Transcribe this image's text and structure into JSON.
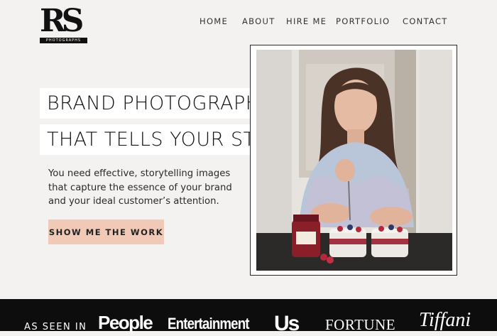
{
  "logo": {
    "mark": "RS",
    "sub": "PHOTOGRAPHS"
  },
  "nav": [
    {
      "label": "HOME"
    },
    {
      "label": "ABOUT"
    },
    {
      "label": "HIRE ME"
    },
    {
      "label": "PORTFOLIO"
    },
    {
      "label": "CONTACT"
    }
  ],
  "hero": {
    "headline_line1": "BRAND PHOTOGRAPHY",
    "headline_line2": "THAT TELLS YOUR STORY.",
    "description_lines": [
      "You need effective, storytelling images",
      "that capture the essence of your brand",
      "and your ideal customer’s attention."
    ],
    "cta_label": "SHOW ME THE WORK"
  },
  "footer": {
    "as_seen_in": "AS SEEN IN",
    "press": [
      "People",
      "Entertainment",
      "Us",
      "FORTUNE",
      "Tiffani"
    ]
  },
  "colors": {
    "cta_bg": "#f0c9b7",
    "band_bg": "#0d0d0d",
    "page_bg": "#f4f2f0"
  }
}
